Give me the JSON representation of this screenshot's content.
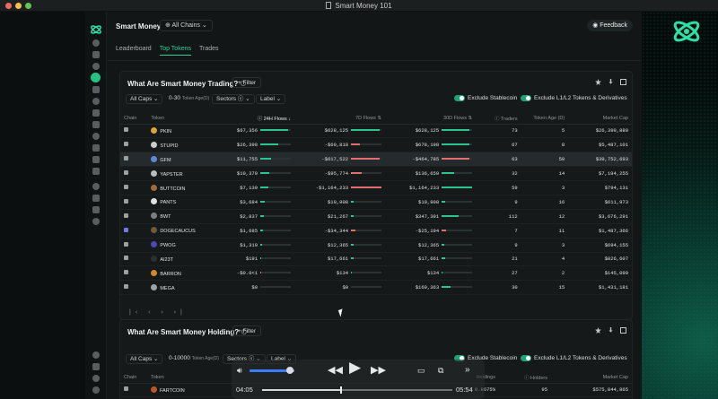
{
  "window": {
    "title": "Smart Money 101"
  },
  "app": {
    "brand": "Smart Money",
    "chain_selector": "All Chains",
    "feedback": "Feedback",
    "tabs": [
      {
        "label": "Leaderboard",
        "active": false
      },
      {
        "label": "Top Tokens",
        "active": true
      },
      {
        "label": "Trades",
        "active": false
      }
    ]
  },
  "trading": {
    "title": "What Are Smart Money Trading?",
    "filter": "Filter",
    "filters": {
      "caps": "All Caps",
      "age_range": "0-30",
      "age_label": "Token Age(D)",
      "sectors": "Sectors",
      "label": "Label",
      "exclude_stablecoin": "Exclude Stablecoin",
      "exclude_l1l2": "Exclude L1/L2 Tokens & Derivatives"
    },
    "columns": [
      "Chain",
      "Token",
      "24H Flows",
      "7D Flows",
      "30D Flows",
      "Traders",
      "Token Age (D)",
      "Market Cap"
    ],
    "rows": [
      {
        "token": "PKIN",
        "f24": "$67,356",
        "f7": "$628,125",
        "f30": "$628,125",
        "traders": "73",
        "age": "5",
        "mcap": "$26,399,889",
        "b24": 0.9,
        "b7": 0.95,
        "b30": 0.9,
        "s24": "pos",
        "s7": "pos",
        "s30": "pos",
        "icon": "#e0a23a"
      },
      {
        "token": "STUPID",
        "f24": "$26,398",
        "f7": "-$69,818",
        "f30": "$678,198",
        "traders": "67",
        "age": "8",
        "mcap": "$5,487,101",
        "b24": 0.6,
        "b7": 0.3,
        "b30": 0.9,
        "s24": "pos",
        "s7": "neg",
        "s30": "pos",
        "icon": "#c9cdd0"
      },
      {
        "token": "GFM",
        "f24": "$11,755",
        "f7": "-$617,522",
        "f30": "-$464,785",
        "traders": "63",
        "age": "50",
        "mcap": "$39,752,693",
        "b24": 0.35,
        "b7": 0.95,
        "b30": 0.9,
        "s24": "pos",
        "s7": "neg",
        "s30": "neg",
        "icon": "#5d88d8"
      },
      {
        "token": "YAPSTER",
        "f24": "$10,379",
        "f7": "-$95,774",
        "f30": "$136,650",
        "traders": "32",
        "age": "14",
        "mcap": "$7,194,255",
        "b24": 0.3,
        "b7": 0.35,
        "b30": 0.4,
        "s24": "pos",
        "s7": "neg",
        "s30": "pos",
        "icon": "#b9bdc0"
      },
      {
        "token": "BUTTCOIN",
        "f24": "$7,139",
        "f7": "-$1,164,233",
        "f30": "$1,164,233",
        "traders": "59",
        "age": "3",
        "mcap": "$794,131",
        "b24": 0.25,
        "b7": 1.0,
        "b30": 1.0,
        "s24": "pos",
        "s7": "neg",
        "s30": "pos",
        "icon": "#a36a3a"
      },
      {
        "token": "PANTS",
        "f24": "$3,684",
        "f7": "$19,908",
        "f30": "$19,908",
        "traders": "9",
        "age": "16",
        "mcap": "$611,973",
        "b24": 0.15,
        "b7": 0.1,
        "b30": 0.1,
        "s24": "pos",
        "s7": "pos",
        "s30": "pos",
        "icon": "#dfe2e3"
      },
      {
        "token": "BWT",
        "f24": "$2,837",
        "f7": "$21,267",
        "f30": "$347,391",
        "traders": "112",
        "age": "12",
        "mcap": "$3,676,291",
        "b24": 0.12,
        "b7": 0.1,
        "b30": 0.55,
        "s24": "pos",
        "s7": "pos",
        "s30": "pos",
        "icon": "#7a7f82"
      },
      {
        "token": "DOGECAUCUS",
        "f24": "$1,685",
        "f7": "-$34,344",
        "f30": "-$25,194",
        "traders": "7",
        "age": "11",
        "mcap": "$1,487,366",
        "b24": 0.08,
        "b7": 0.15,
        "b30": 0.15,
        "s24": "pos",
        "s7": "neg",
        "s30": "neg",
        "icon": "#6e5a3a"
      },
      {
        "token": "PWOG",
        "f24": "$1,319",
        "f7": "$12,365",
        "f30": "$12,365",
        "traders": "9",
        "age": "3",
        "mcap": "$694,155",
        "b24": 0.06,
        "b7": 0.08,
        "b30": 0.08,
        "s24": "pos",
        "s7": "pos",
        "s30": "pos",
        "icon": "#4f46b8"
      },
      {
        "token": "AI23T",
        "f24": "$191",
        "f7": "$17,661",
        "f30": "$17,661",
        "traders": "21",
        "age": "4",
        "mcap": "$826,607",
        "b24": 0.02,
        "b7": 0.1,
        "b30": 0.1,
        "s24": "pos",
        "s7": "pos",
        "s30": "pos",
        "icon": "#2b2f30"
      },
      {
        "token": "BARRON",
        "f24": "-$0.0<1",
        "f7": "$134",
        "f30": "$134",
        "traders": "27",
        "age": "2",
        "mcap": "$145,099",
        "b24": 0.01,
        "b7": 0.02,
        "b30": 0.02,
        "s24": "neg",
        "s7": "pos",
        "s30": "pos",
        "icon": "#d48a2a"
      },
      {
        "token": "MEGA",
        "f24": "$0",
        "f7": "$0",
        "f30": "$169,363",
        "traders": "30",
        "age": "15",
        "mcap": "$1,431,181",
        "b24": 0.0,
        "b7": 0.0,
        "b30": 0.3,
        "s24": "neg",
        "s7": "neg",
        "s30": "pos",
        "icon": "#9ea4a6"
      }
    ]
  },
  "holding": {
    "title": "What Are Smart Money Holding?",
    "filter": "Filter",
    "filters": {
      "caps": "All Caps",
      "age_range": "0-10000",
      "age_label": "Token Age(D)",
      "sectors": "Sectors",
      "label": "Label",
      "exclude_stablecoin": "Exclude Stablecoin",
      "exclude_l1l2": "Exclude L1/L2 Tokens & Derivatives"
    },
    "columns": [
      "Chain",
      "Token",
      "Holdings",
      "Holders",
      "Market Cap"
    ],
    "row": {
      "token": "FARTCOIN",
      "holdings": "0.8675%",
      "holders": "95",
      "mcap": "$575,844,865"
    }
  },
  "player": {
    "elapsed": "04:05",
    "remaining": "05:54",
    "volume": 0.9,
    "progress": 0.41
  }
}
